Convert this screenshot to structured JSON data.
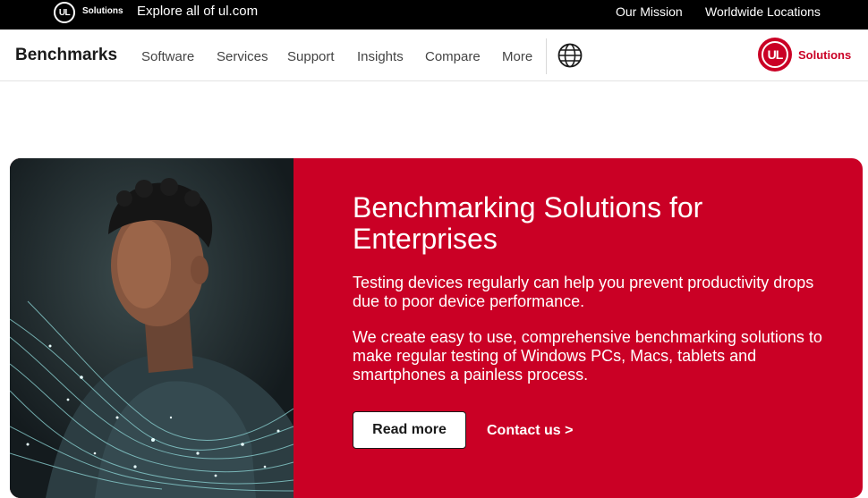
{
  "topbar": {
    "logo_text": "UL",
    "logo_label": "Solutions",
    "explore": "Explore all of ul.com",
    "links": [
      "Our Mission",
      "Worldwide Locations"
    ]
  },
  "nav": {
    "brand": "Benchmarks",
    "items": [
      "Software",
      "Services",
      "Support",
      "Insights",
      "Compare",
      "More"
    ],
    "globe_icon": "globe-icon",
    "logo_text": "UL",
    "logo_label": "Solutions"
  },
  "hero": {
    "title": "Benchmarking Solutions for Enterprises",
    "p1": "Testing devices regularly can help you prevent productivity drops due to poor device performance.",
    "p2": "We create easy to use, comprehensive benchmarking solutions to make regular testing of Windows PCs, Macs, tablets and smartphones a painless process.",
    "read_more": "Read more",
    "contact": "Contact us >"
  },
  "colors": {
    "brand_red": "#ca0025",
    "topbar": "#000000"
  }
}
